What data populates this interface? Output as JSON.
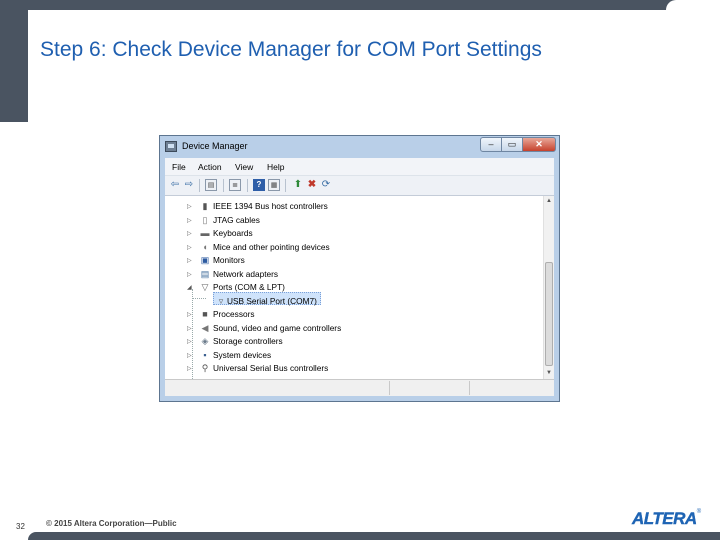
{
  "slide": {
    "title": "Step 6: Check Device Manager for COM Port Settings",
    "page_number": "32",
    "copyright": "© 2015 Altera Corporation—Public",
    "logo": "ALTERA",
    "logo_reg": "®"
  },
  "window": {
    "title": "Device Manager",
    "buttons": {
      "minimize": "–",
      "maximize": "▭",
      "close": "✕"
    },
    "menu": [
      "File",
      "Action",
      "View",
      "Help"
    ],
    "tree": [
      {
        "label": "IEEE 1394 Bus host controllers",
        "expander": "▷",
        "icon": "ieee1394-icon"
      },
      {
        "label": "JTAG cables",
        "expander": "▷",
        "icon": "jtag-cable-icon"
      },
      {
        "label": "Keyboards",
        "expander": "▷",
        "icon": "keyboard-icon"
      },
      {
        "label": "Mice and other pointing devices",
        "expander": "▷",
        "icon": "mouse-icon"
      },
      {
        "label": "Monitors",
        "expander": "▷",
        "icon": "monitor-icon"
      },
      {
        "label": "Network adapters",
        "expander": "▷",
        "icon": "network-adapter-icon"
      },
      {
        "label": "Ports (COM & LPT)",
        "expander": "◢",
        "icon": "port-icon"
      },
      {
        "label": "USB Serial Port (COM7)",
        "expander": "",
        "icon": "serial-port-icon"
      },
      {
        "label": "Processors",
        "expander": "▷",
        "icon": "processor-icon"
      },
      {
        "label": "Sound, video and game controllers",
        "expander": "▷",
        "icon": "sound-icon"
      },
      {
        "label": "Storage controllers",
        "expander": "▷",
        "icon": "storage-icon"
      },
      {
        "label": "System devices",
        "expander": "▷",
        "icon": "system-devices-icon"
      },
      {
        "label": "Universal Serial Bus controllers",
        "expander": "▷",
        "icon": "usb-icon"
      }
    ]
  },
  "colors": {
    "title_blue": "#1f5fb0",
    "chrome_gray": "#4a5461",
    "window_frame": "#b9cfe8",
    "close_red": "#c6412d"
  }
}
